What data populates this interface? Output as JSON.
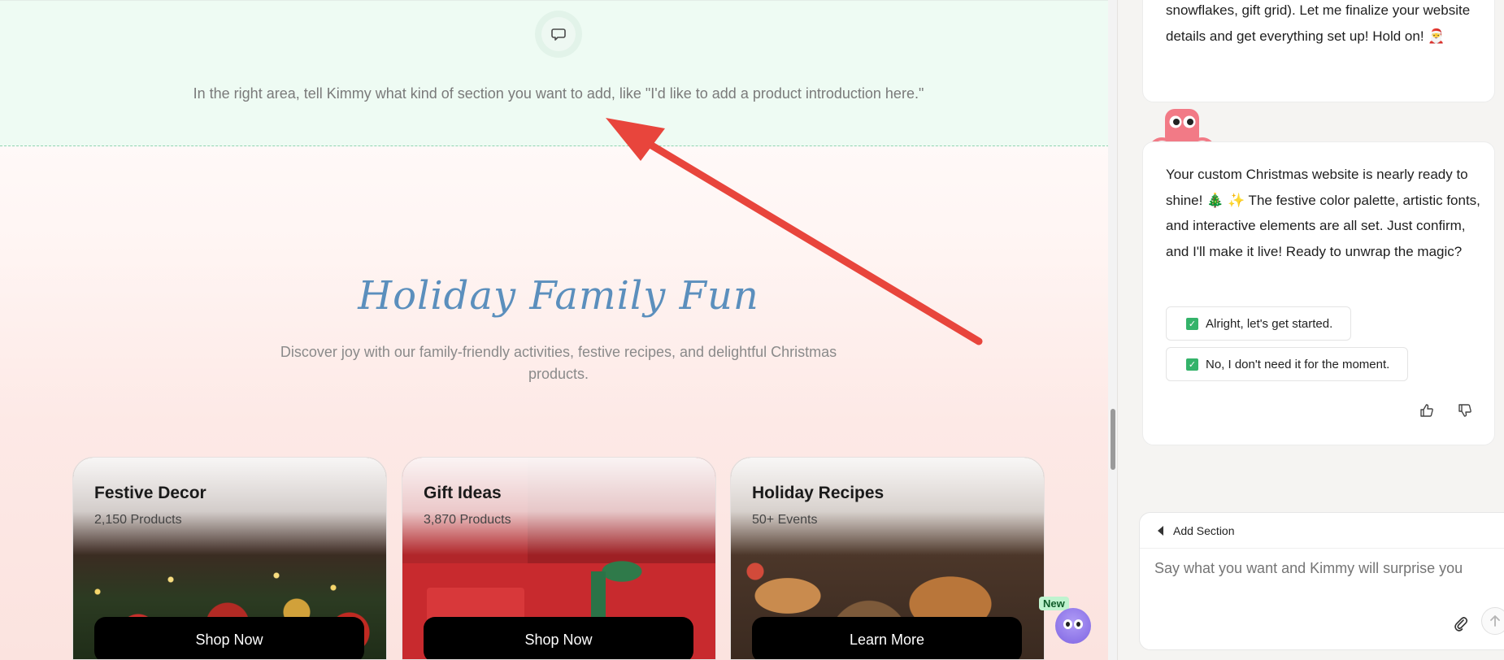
{
  "preview": {
    "banner_hint": "In the right area, tell Kimmy what kind of section you want to add, like \"I'd like to add a product introduction here.\"",
    "section_title": "Holiday Family Fun",
    "section_desc": "Discover joy with our family-friendly activities, festive recipes, and delightful Christmas products.",
    "cards": [
      {
        "title": "Festive Decor",
        "subtitle": "2,150 Products",
        "button": "Shop Now"
      },
      {
        "title": "Gift Ideas",
        "subtitle": "3,870 Products",
        "button": "Shop Now"
      },
      {
        "title": "Holiday Recipes",
        "subtitle": "50+ Events",
        "button": "Learn More"
      }
    ],
    "new_badge": "New"
  },
  "chat": {
    "prev_message": "snowflakes, gift grid). Let me finalize your website details and get everything set up! Hold on! 🎅",
    "main_message": "Your custom Christmas website is nearly ready to shine! 🎄 ✨ The festive color palette, artistic fonts, and interactive elements are all set. Just confirm, and I'll make it live! Ready to unwrap the magic?",
    "options": [
      "Alright, let's get started.",
      "No, I don't need it for the moment."
    ],
    "input": {
      "mode_label": "Add Section",
      "placeholder": "Say what you want and Kimmy will surprise you"
    }
  },
  "colors": {
    "banner_bg": "#eefbf3",
    "title_color": "#5b8fbd",
    "arrow_color": "#e8453c",
    "check_green": "#34b36a",
    "kimmy_pink": "#f27a86"
  }
}
